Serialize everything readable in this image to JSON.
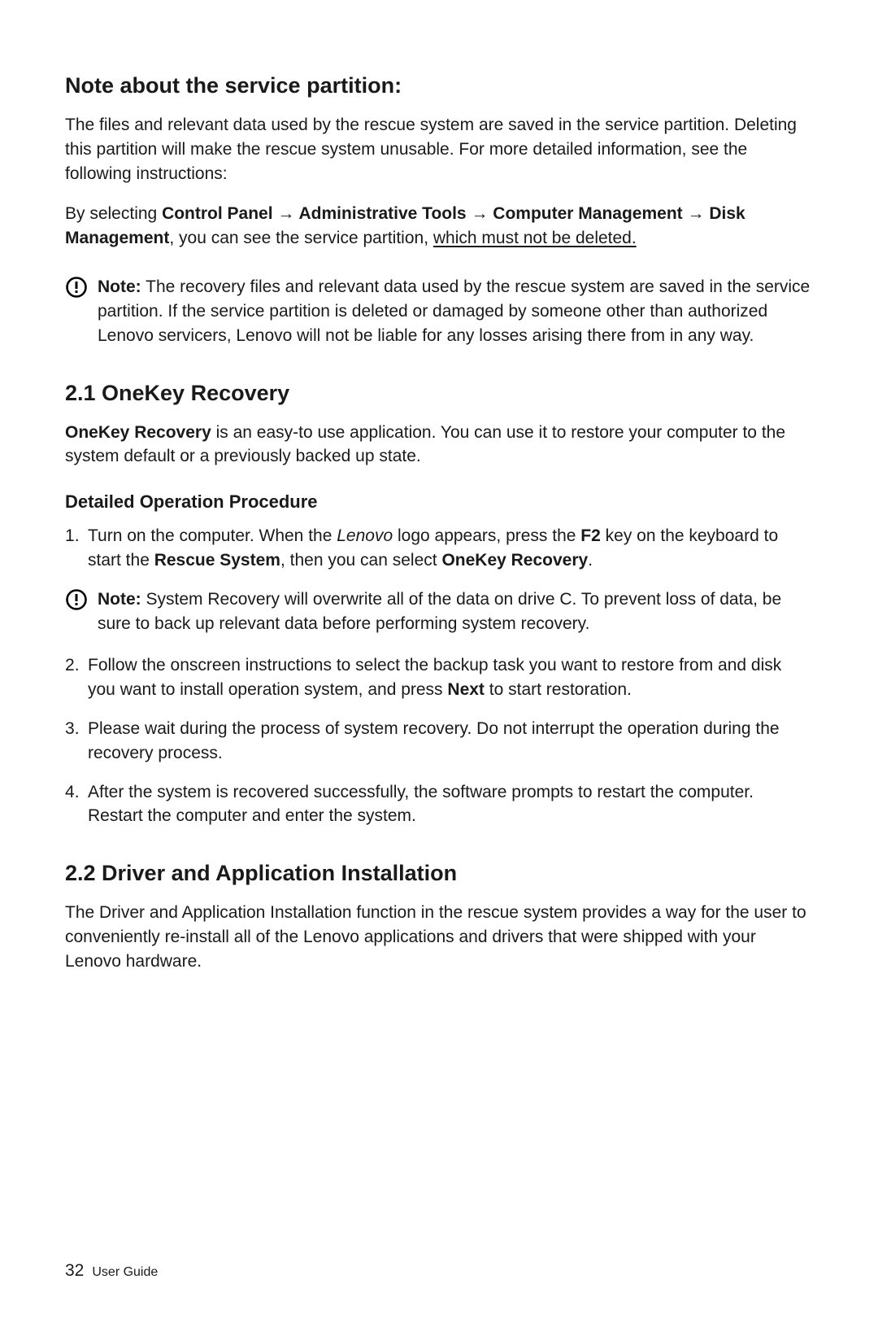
{
  "head1": "Note about the service partition:",
  "para1": "The files and relevant data used by the rescue system are saved in the service partition. Deleting this partition will make the rescue system unusable. For more detailed information, see the following instructions:",
  "nav": {
    "prefix": "By selecting ",
    "cp": "Control Panel",
    "arrow": " → ",
    "at": "Administrative Tools",
    "cm": "Computer Management",
    "dm": "Disk Management",
    "mid": ", you can see the service partition, ",
    "ul": "which must not be deleted."
  },
  "note1": {
    "label": "Note:",
    "text": " The recovery files and relevant data used by the rescue system are saved in the service partition. If the service partition is deleted or damaged by someone other than authorized Lenovo servicers, Lenovo will not be liable for any losses arising there from in any way."
  },
  "head2": "2.1 OneKey Recovery",
  "para2": {
    "b": "OneKey Recovery",
    "rest": " is an easy-to use application. You can use it to restore your computer to the system default or a previously backed up state."
  },
  "subhead": "Detailed Operation Procedure",
  "step1": {
    "a": "Turn on the computer. When the ",
    "lenovo": "Lenovo",
    "b": " logo appears, press the ",
    "f2": "F2",
    "c": " key on the keyboard to start the ",
    "rs": "Rescue System",
    "d": ", then you can select ",
    "okr": "OneKey Recovery",
    "e": "."
  },
  "note2": {
    "label": "Note:",
    "text": " System Recovery will overwrite all of the data on drive C. To prevent loss of data, be sure to back up relevant data before performing system recovery."
  },
  "step2": {
    "a": "Follow the onscreen instructions to select the backup task you want to restore from and disk you want to install operation system, and press ",
    "next": "Next",
    "b": " to start restoration."
  },
  "step3": "Please wait during the process of system recovery. Do not interrupt the operation during the recovery process.",
  "step4": "After the system is recovered successfully, the software prompts to restart the computer. Restart the computer and enter the system.",
  "head3": "2.2 Driver and Application Installation",
  "para3": "The Driver and Application Installation function in the rescue system provides a way for the user to conveniently re-install all of the Lenovo applications and drivers that were shipped with your Lenovo hardware.",
  "footer": {
    "page": "32",
    "label": "User Guide"
  }
}
